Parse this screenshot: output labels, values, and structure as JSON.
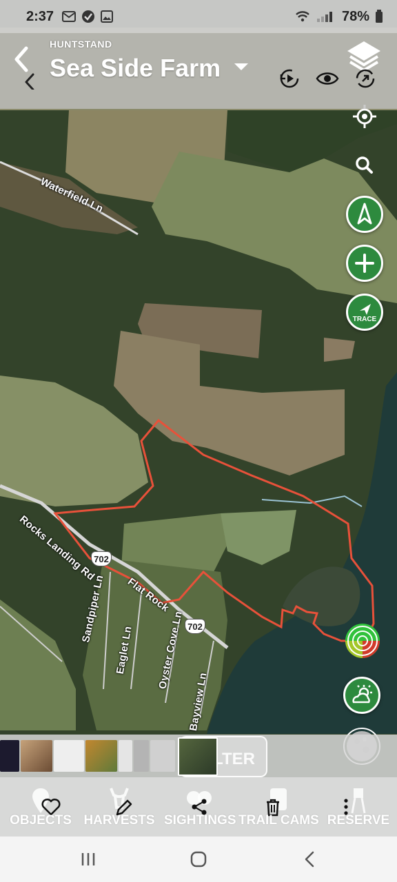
{
  "status_bar": {
    "time": "2:37",
    "battery": "78%",
    "left_icons": [
      "gmail-icon",
      "check-circle-icon",
      "gallery-icon"
    ],
    "right_icons": [
      "wifi-icon",
      "signal-icon",
      "battery-icon"
    ]
  },
  "header": {
    "app_name": "HUNTSTAND",
    "farm_name": "Sea Side Farm",
    "tools": [
      "replay-icon",
      "eye-icon",
      "sync-icon"
    ]
  },
  "map": {
    "road_labels": {
      "waterfield": "Waterfield Ln",
      "rocks_landing": "Rocks Landing Rd",
      "flat_rock": "Flat Rock",
      "sandpiper": "Sandpiper Ln",
      "eaglet": "Eaglet Ln",
      "oyster_cove": "Oyster Cove Ln",
      "bayview": "Bayview Ln"
    },
    "route_shields": [
      "702",
      "702"
    ],
    "boundary_color": "#e8513a",
    "controls": {
      "trace_label": "TRACE",
      "buttons": [
        "locate-icon",
        "search-icon",
        "compass-icon",
        "add-icon",
        "trace-icon",
        "radar-icon",
        "weather-icon",
        "moon-icon"
      ]
    }
  },
  "thumb_strip": {
    "filter_label": "FILTER"
  },
  "bottom_nav": {
    "items": [
      {
        "label": "OBJECTS",
        "action_icon": "heart-icon"
      },
      {
        "label": "HARVESTS",
        "action_icon": "pencil-icon"
      },
      {
        "label": "SIGHTINGS",
        "action_icon": "share-icon"
      },
      {
        "label": "TRAIL CAMS",
        "action_icon": "trash-icon"
      },
      {
        "label": "RESERVE",
        "action_icon": "more-vertical-icon"
      }
    ]
  },
  "colors": {
    "accent_green": "#2d8a3e",
    "header_bg": "#bebebe",
    "boundary": "#e8513a"
  }
}
